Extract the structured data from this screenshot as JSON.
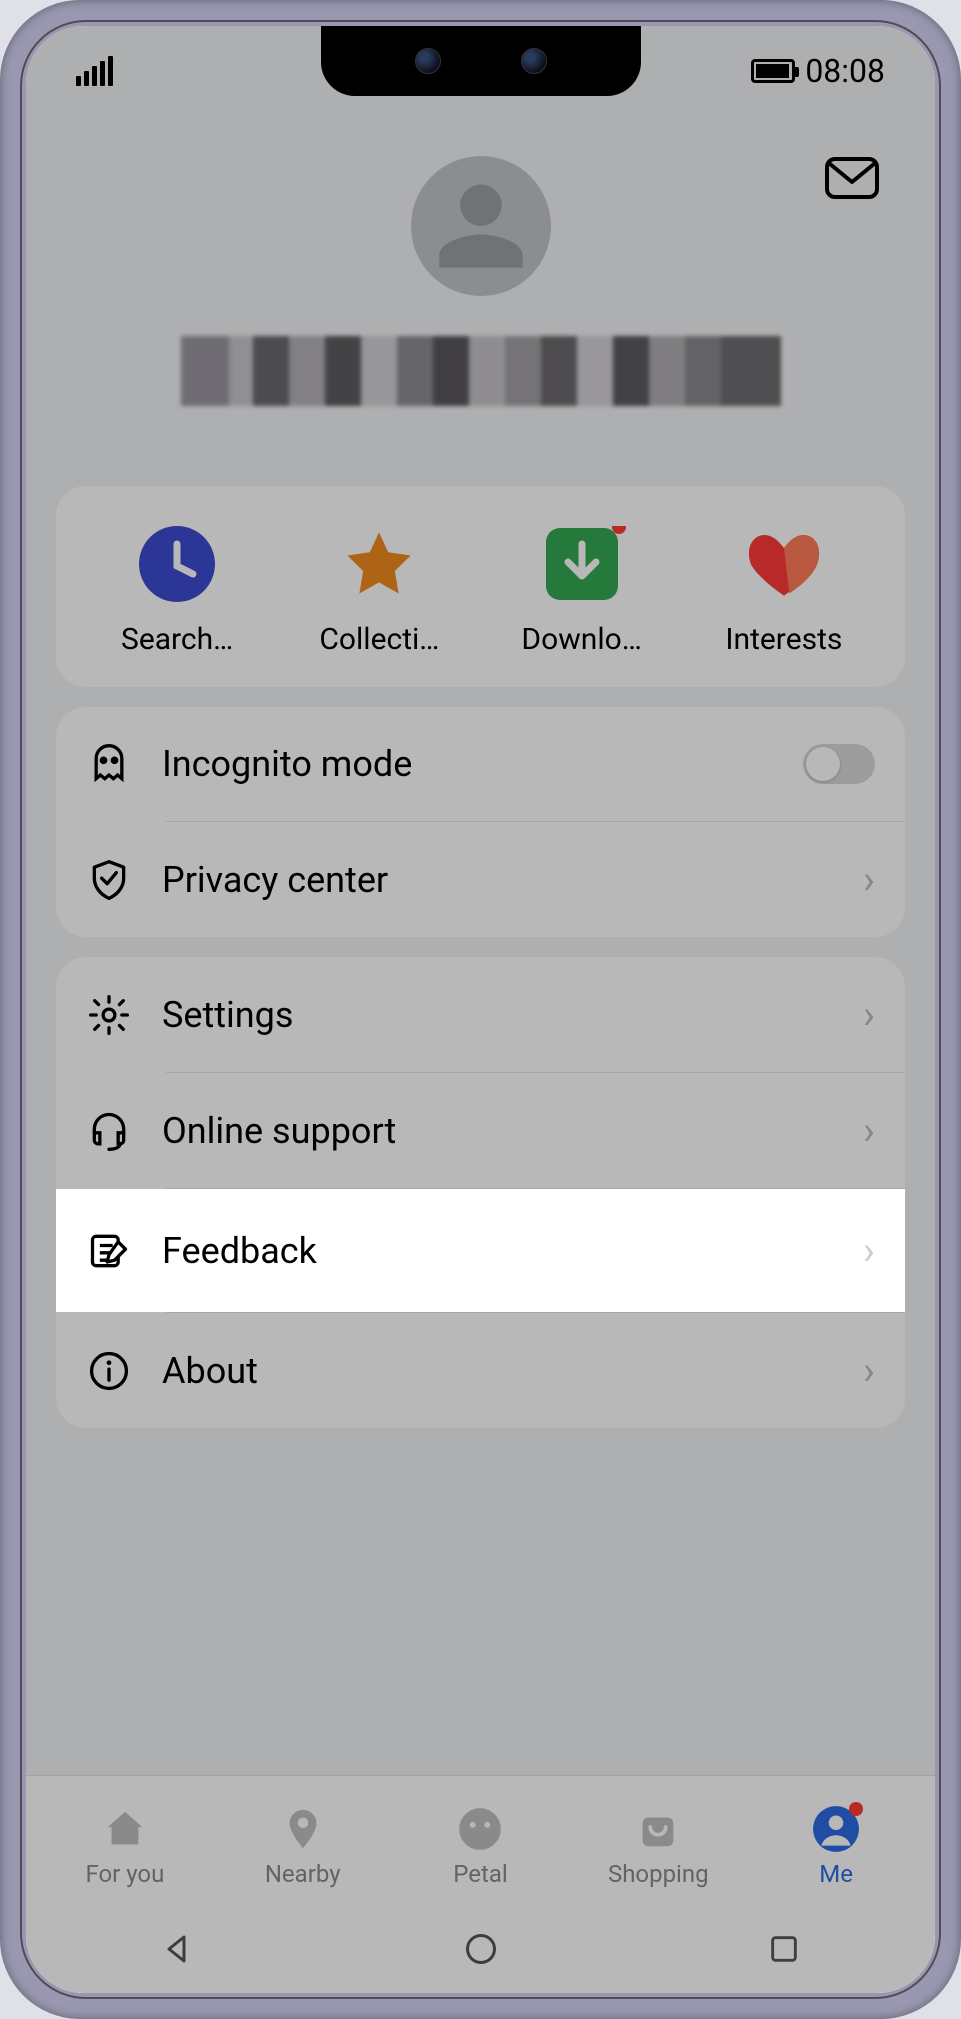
{
  "status": {
    "time": "08:08"
  },
  "profile": {
    "name_redacted": true
  },
  "quick": [
    {
      "id": "search-history-tile",
      "label": "Search…",
      "icon": "clock",
      "color": "#3d4bd1",
      "badge": false
    },
    {
      "id": "collections-tile",
      "label": "Collecti…",
      "icon": "star",
      "color": "#f08b1e",
      "badge": false
    },
    {
      "id": "downloads-tile",
      "label": "Downlo…",
      "icon": "download",
      "color": "#34a853",
      "badge": true
    },
    {
      "id": "interests-tile",
      "label": "Interests",
      "icon": "heart",
      "color": "#ff4d4d",
      "badge": false
    }
  ],
  "group1": {
    "incognito": {
      "label": "Incognito mode",
      "toggled": false
    },
    "privacy": {
      "label": "Privacy center"
    }
  },
  "group2": {
    "settings": {
      "label": "Settings"
    },
    "support": {
      "label": "Online support"
    },
    "feedback": {
      "label": "Feedback"
    },
    "about": {
      "label": "About"
    }
  },
  "nav": {
    "items": [
      {
        "id": "nav-for-you",
        "label": "For you",
        "icon": "home"
      },
      {
        "id": "nav-nearby",
        "label": "Nearby",
        "icon": "pin"
      },
      {
        "id": "nav-petal",
        "label": "Petal",
        "icon": "face"
      },
      {
        "id": "nav-shopping",
        "label": "Shopping",
        "icon": "bag"
      },
      {
        "id": "nav-me",
        "label": "Me",
        "icon": "person",
        "active": true,
        "badge": true
      }
    ]
  },
  "colors": {
    "accent": "#2d6be4"
  }
}
